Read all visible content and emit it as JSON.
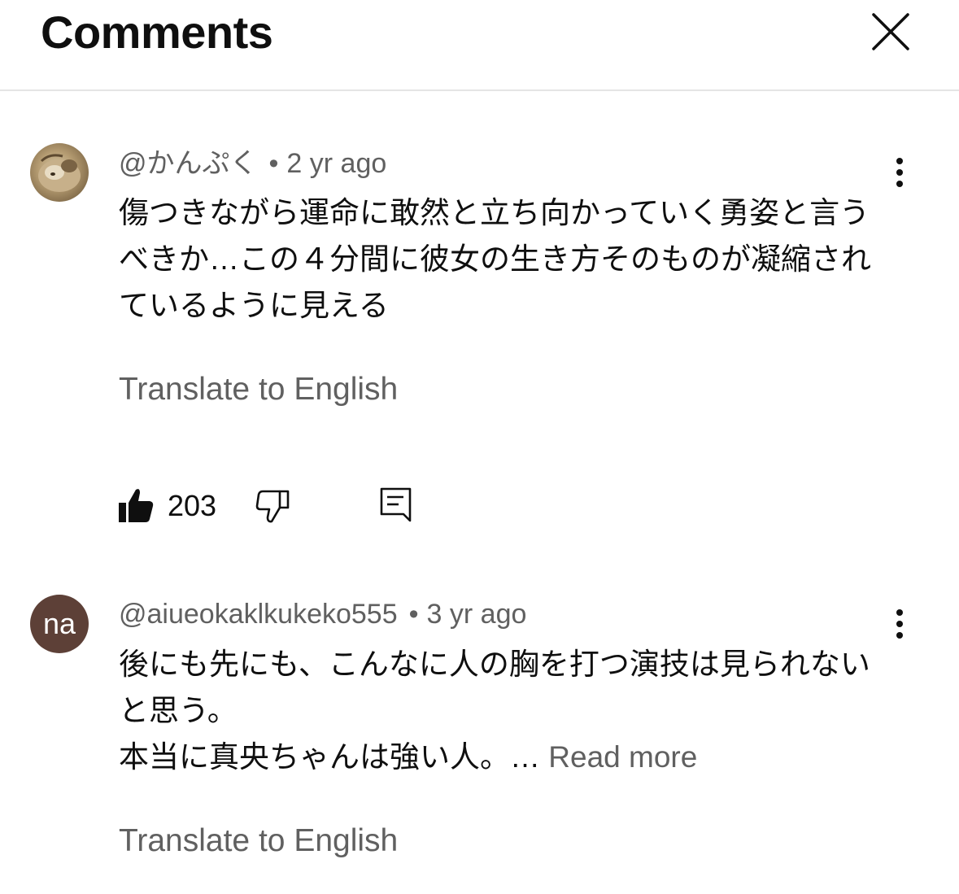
{
  "header": {
    "title": "Comments",
    "close_icon": "close-icon"
  },
  "comments": [
    {
      "avatar_initials": "",
      "author": "@かんぷく",
      "age": "2 yr ago",
      "text": "傷つきながら運命に敢然と立ち向かっていく勇姿と言うべきか…この４分間に彼女の生き方そのものが凝縮されているように見える",
      "read_more": "",
      "translate": "Translate to English",
      "likes": "203"
    },
    {
      "avatar_initials": "na",
      "author": "@aiueokaklkukeko555",
      "age": "3 yr ago",
      "text": "後にも先にも、こんなに人の胸を打つ演技は見られないと思う。\n本当に真央ちゃんは強い人。…",
      "read_more": " Read more",
      "translate": "Translate to English"
    }
  ],
  "colors": {
    "secondary_text": "#606060",
    "avatar_na_bg": "#5d4037",
    "divider": "#e5e5e5"
  }
}
